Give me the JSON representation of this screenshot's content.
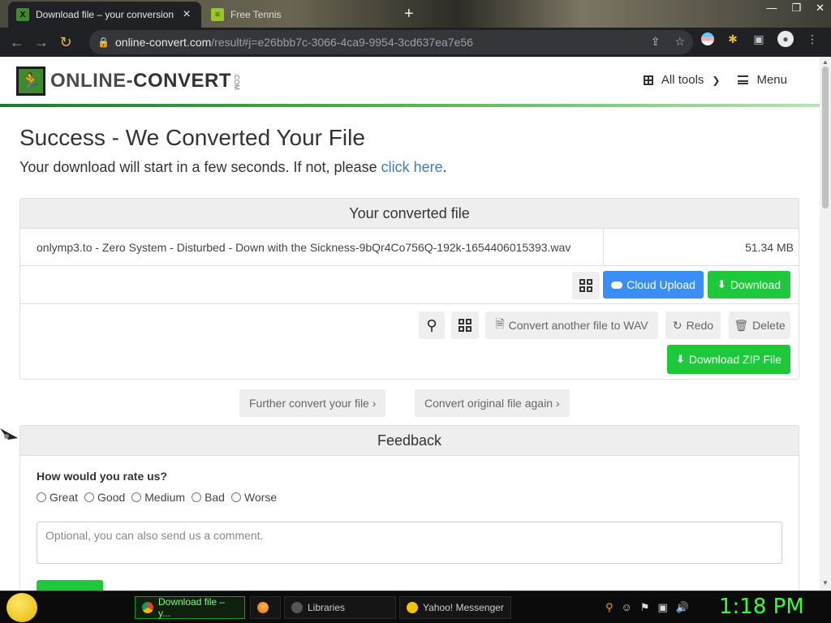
{
  "browser": {
    "tabs": [
      {
        "title": "Download file – your conversion",
        "active": true
      },
      {
        "title": "Free Tennis",
        "active": false
      }
    ],
    "url_host": "online-convert.com",
    "url_path": "/result#j=e26bbb7c-3066-4ca9-9954-3cd637ea7e56"
  },
  "site": {
    "logo_text_1": "ONLINE-",
    "logo_text_2": "CONVERT",
    "logo_com": ".COM",
    "nav": {
      "all_tools": "All tools",
      "menu": "Menu"
    }
  },
  "page": {
    "title": "Success - We Converted Your File",
    "subtitle": "Your download will start in a few seconds. If not, please ",
    "subtitle_link": "click here",
    "subtitle_end": "."
  },
  "converted": {
    "heading": "Your converted file",
    "file_name": "onlymp3.to - Zero System - Disturbed - Down with the Sickness-9bQr4Co756Q-192k-1654406015393.wav",
    "file_size": "51.34 MB",
    "cloud_upload": "Cloud Upload",
    "download": "Download",
    "convert_another": "Convert another file to WAV",
    "redo": "Redo",
    "delete": "Delete",
    "download_zip": "Download ZIP File"
  },
  "further": {
    "further_convert": "Further convert your file",
    "convert_original": "Convert original file again"
  },
  "feedback": {
    "heading": "Feedback",
    "question": "How would you rate us?",
    "options": [
      "Great",
      "Good",
      "Medium",
      "Bad",
      "Worse"
    ],
    "comment_placeholder": "Optional, you can also send us a comment."
  },
  "taskbar": {
    "items": [
      "Download file – y...",
      "Libraries",
      "Yahoo! Messenger"
    ],
    "clock": "1:18 PM"
  },
  "colors": {
    "brand_green": "#4caf50",
    "download_green": "#1ec83b",
    "cloud_blue": "#3a8ef6",
    "link_blue": "#3f7cb5"
  }
}
